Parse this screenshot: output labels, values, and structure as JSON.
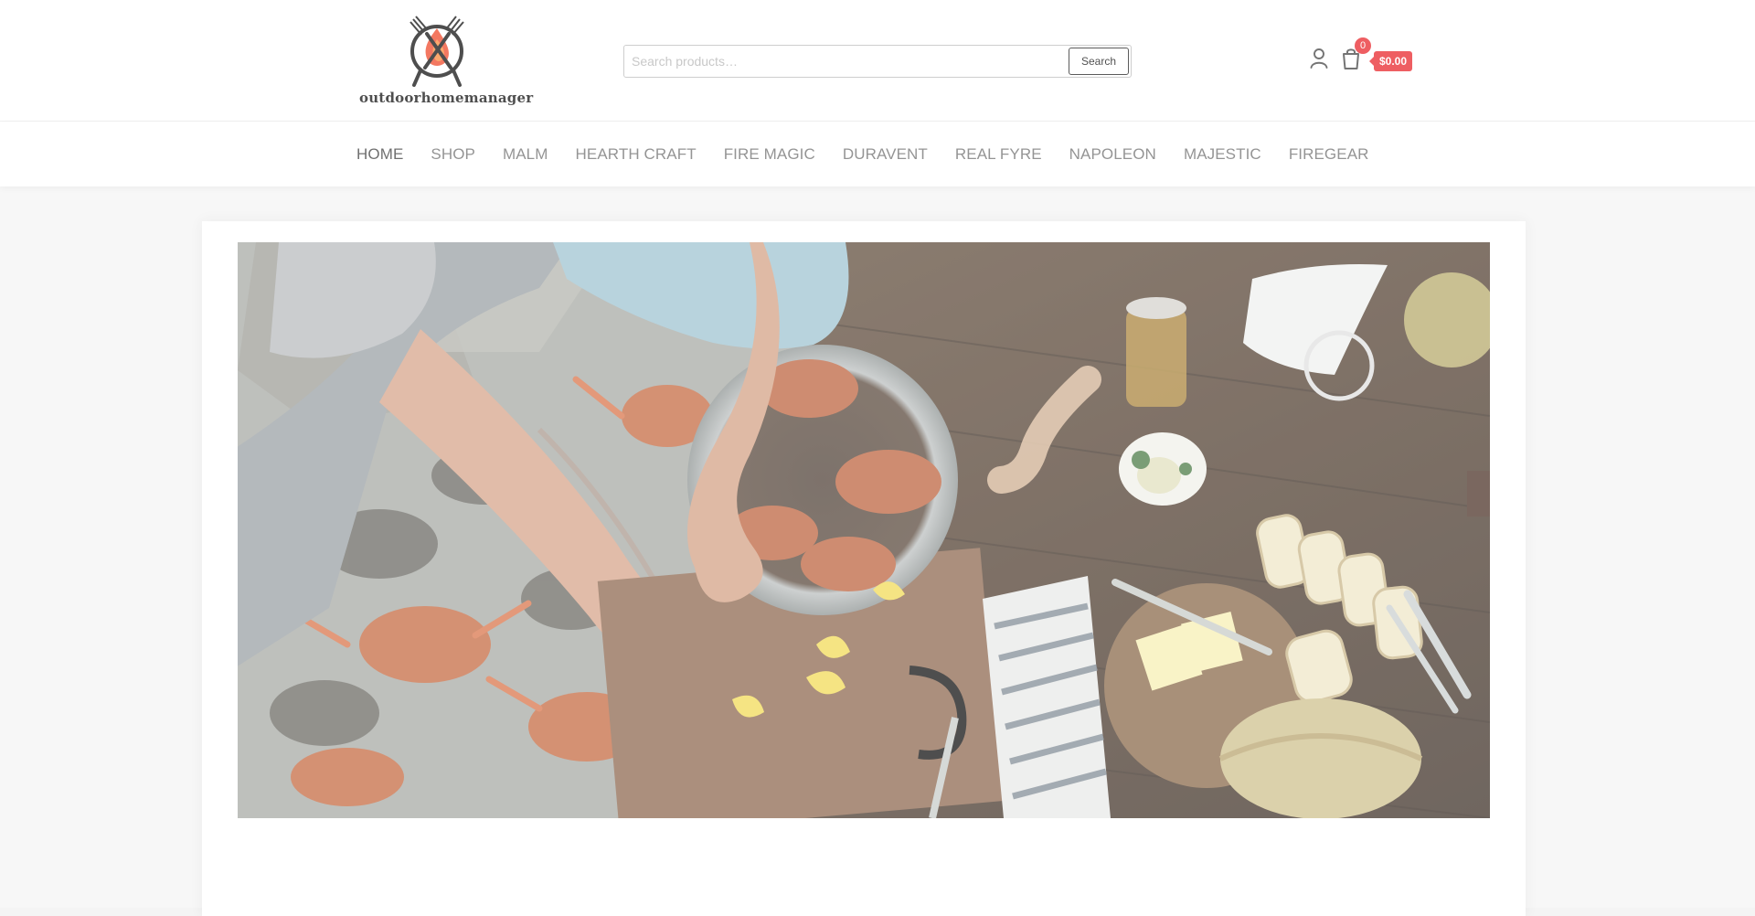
{
  "logo": {
    "text": "outdoorhomemanager",
    "icon": "grill-flame-logo"
  },
  "search": {
    "placeholder": "Search products…",
    "button_label": "Search"
  },
  "header_icons": {
    "account": "user-icon",
    "cart": "shopping-bag-icon",
    "cart_count": "0",
    "cart_total": "$0.00"
  },
  "nav": {
    "items": [
      {
        "label": "HOME"
      },
      {
        "label": "SHOP"
      },
      {
        "label": "MALM"
      },
      {
        "label": "HEARTH CRAFT"
      },
      {
        "label": "FIRE MAGIC"
      },
      {
        "label": "DURAVENT"
      },
      {
        "label": "REAL FYRE"
      },
      {
        "label": "NAPOLEON"
      },
      {
        "label": "MAJESTIC"
      },
      {
        "label": "FIREGEAR"
      }
    ],
    "active_index": 0
  },
  "colors": {
    "accent": "#e8262c",
    "header_bg": "#ffffff",
    "page_bg": "#f4f4f4"
  }
}
